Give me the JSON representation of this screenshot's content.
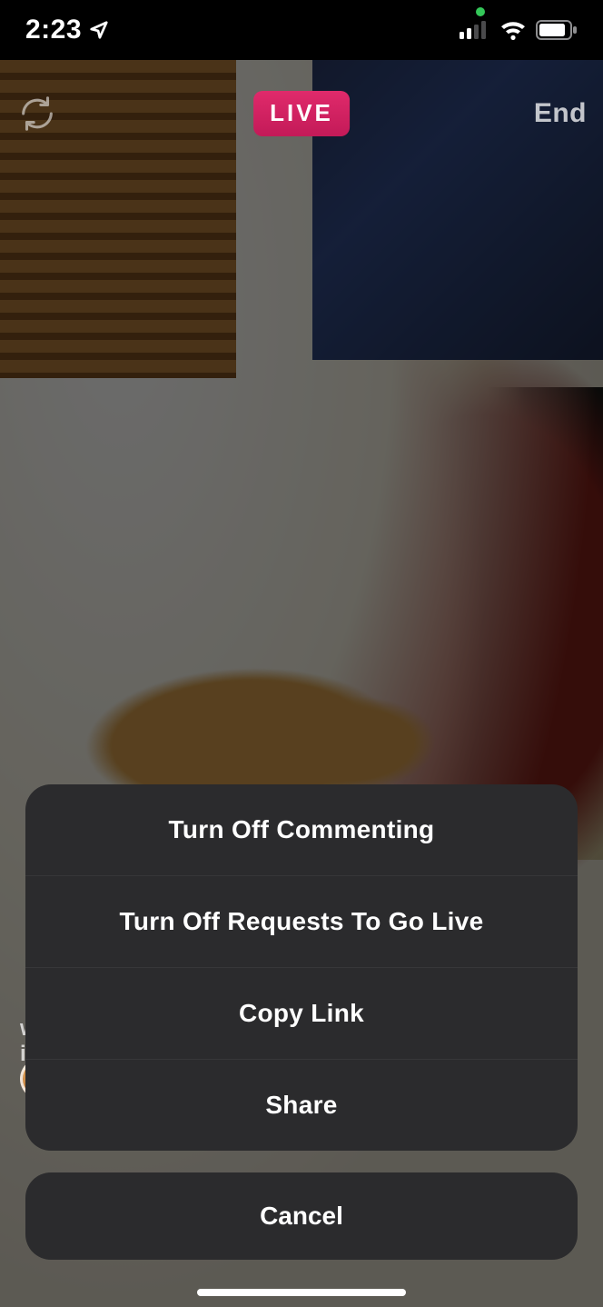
{
  "status_bar": {
    "time": "2:23",
    "location_on": true,
    "camera_dot": true,
    "signal_bars": 2,
    "wifi_bars": 3,
    "battery_pct": 80
  },
  "live": {
    "badge": "LIVE",
    "end_label": "End"
  },
  "bottom_hint": {
    "line1": "w",
    "line2": "i"
  },
  "action_sheet": {
    "items": [
      {
        "label": "Turn Off Commenting"
      },
      {
        "label": "Turn Off Requests To Go Live"
      },
      {
        "label": "Copy Link"
      },
      {
        "label": "Share"
      }
    ],
    "cancel": "Cancel"
  }
}
